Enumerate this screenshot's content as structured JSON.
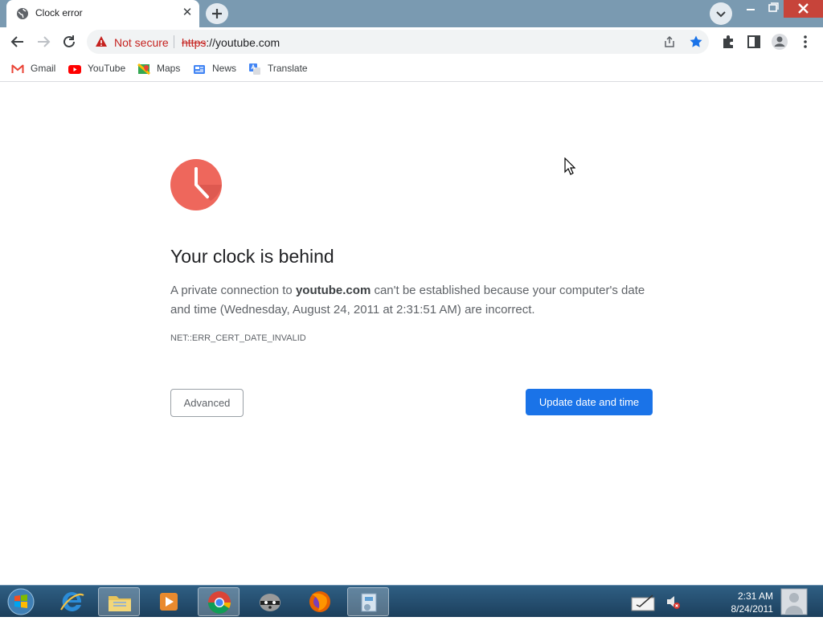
{
  "tab": {
    "title": "Clock error",
    "close_glyph": "✕"
  },
  "omnibox": {
    "security_label": "Not secure",
    "url_scheme": "https",
    "url_rest": "://youtube.com"
  },
  "bookmarks": [
    {
      "label": "Gmail",
      "icon": "gmail-icon"
    },
    {
      "label": "YouTube",
      "icon": "youtube-icon"
    },
    {
      "label": "Maps",
      "icon": "maps-icon"
    },
    {
      "label": "News",
      "icon": "news-icon"
    },
    {
      "label": "Translate",
      "icon": "translate-icon"
    }
  ],
  "page": {
    "heading": "Your clock is behind",
    "desc_pre": "A private connection to ",
    "desc_host": "youtube.com",
    "desc_post": " can't be established because your computer's date and time (Wednesday, August 24, 2011 at 2:31:51 AM) are incorrect.",
    "error_code": "NET::ERR_CERT_DATE_INVALID",
    "advanced_label": "Advanced",
    "update_label": "Update date and time"
  },
  "taskbar": {
    "time": "2:31 AM",
    "date": "8/24/2011"
  },
  "colors": {
    "accent": "#1a73e8",
    "clock_icon": "#ee675c",
    "titlebar": "#7a9ab1",
    "taskbar": "#1c3f5c"
  }
}
